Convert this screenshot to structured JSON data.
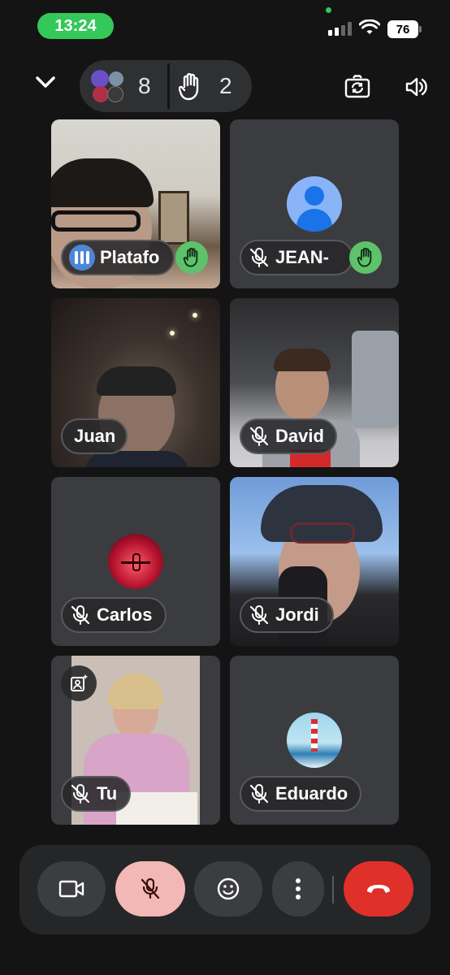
{
  "status_bar": {
    "time": "13:24",
    "battery": "76"
  },
  "top_bar": {
    "participant_count": "8",
    "raised_hands_count": "2"
  },
  "tiles": [
    {
      "name": "Platafo",
      "hand_raised": true
    },
    {
      "name": "JEAN-",
      "hand_raised": true
    },
    {
      "name": "Juan"
    },
    {
      "name": "David"
    },
    {
      "name": "Carlos"
    },
    {
      "name": "Jordi"
    },
    {
      "name": "Tu"
    },
    {
      "name": "Eduardo"
    }
  ],
  "colors": {
    "accent_green": "#34c759",
    "hand_green": "#5ec26a",
    "mic_button_bg": "#f2b8b5",
    "end_call_red": "#e0302a",
    "speaking_blue": "#4d86d6"
  },
  "icons": [
    "chevron-down-icon",
    "raised-hand-icon",
    "camera-flip-icon",
    "speaker-icon",
    "mic-off-icon",
    "video-camera-icon",
    "emoji-icon",
    "more-vert-icon",
    "end-call-icon",
    "add-effect-icon",
    "person-placeholder-icon"
  ]
}
